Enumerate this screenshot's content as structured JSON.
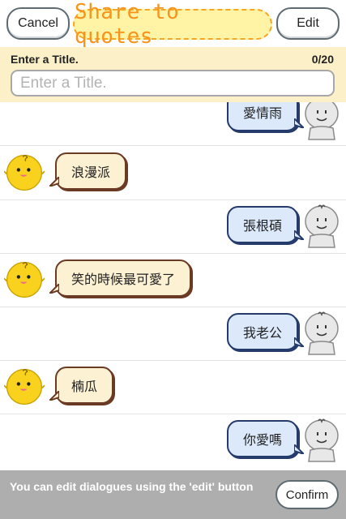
{
  "header": {
    "cancel_label": "Cancel",
    "title": "Share to quotes",
    "edit_label": "Edit"
  },
  "title_entry": {
    "label": "Enter a Title.",
    "counter": "0/20",
    "placeholder": "Enter a Title.",
    "value": ""
  },
  "messages": [
    {
      "side": "right",
      "speaker": "user",
      "text": "愛情雨"
    },
    {
      "side": "left",
      "speaker": "simsimi",
      "text": "浪漫派"
    },
    {
      "side": "right",
      "speaker": "user",
      "text": "張根碩"
    },
    {
      "side": "left",
      "speaker": "simsimi",
      "text": "笑的時候最可愛了"
    },
    {
      "side": "right",
      "speaker": "user",
      "text": "我老公"
    },
    {
      "side": "left",
      "speaker": "simsimi",
      "text": "楠瓜"
    },
    {
      "side": "right",
      "speaker": "user",
      "text": "你愛嗎"
    }
  ],
  "footer": {
    "hint": "You can edit dialogues using the 'edit' button",
    "confirm_label": "Confirm"
  },
  "colors": {
    "title_text": "#f7941d",
    "title_bg": "#fff3a6",
    "title_bar_bg": "#fbf0c8",
    "right_bubble_bg": "#dce9fb",
    "left_bubble_bg": "#fdf1d4",
    "footer_bg": "#aeaeae"
  },
  "icons": {
    "user_avatar": "grey-stickman-avatar-icon",
    "bot_avatar": "yellow-chick-avatar-icon"
  }
}
